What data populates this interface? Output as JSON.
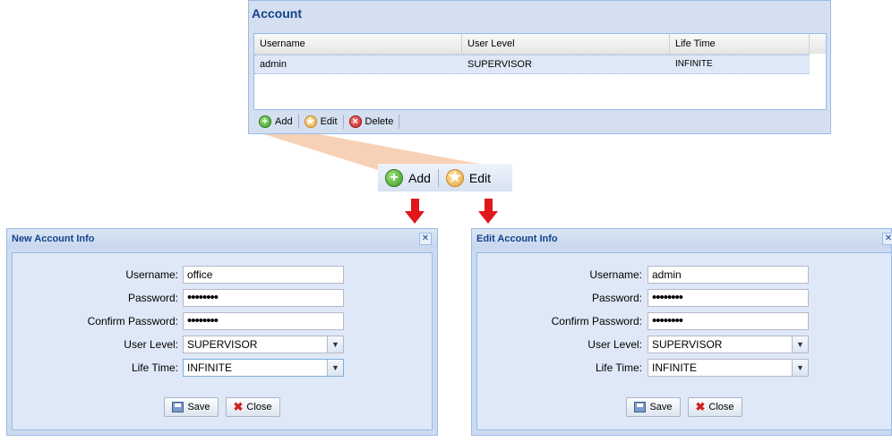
{
  "account": {
    "title": "Account",
    "columns": [
      "Username",
      "User Level",
      "Life Time"
    ],
    "rows": [
      [
        "admin",
        "SUPERVISOR",
        "INFINITE"
      ]
    ],
    "toolbar": {
      "add": "Add",
      "edit": "Edit",
      "delete": "Delete"
    }
  },
  "zoom": {
    "add": "Add",
    "edit": "Edit"
  },
  "new_dialog": {
    "title": "New Account Info",
    "labels": {
      "username": "Username:",
      "password": "Password:",
      "confirm": "Confirm Password:",
      "level": "User Level:",
      "lifetime": "Life Time:"
    },
    "values": {
      "username": "office",
      "password": "••••••••",
      "confirm": "••••••••",
      "level": "SUPERVISOR",
      "lifetime": "INFINITE"
    },
    "save": "Save",
    "close": "Close"
  },
  "edit_dialog": {
    "title": "Edit Account Info",
    "labels": {
      "username": "Username:",
      "password": "Password:",
      "confirm": "Confirm Password:",
      "level": "User Level:",
      "lifetime": "Life Time:"
    },
    "values": {
      "username": "admin",
      "password": "••••••••",
      "confirm": "••••••••",
      "level": "SUPERVISOR",
      "lifetime": "INFINITE"
    },
    "save": "Save",
    "close": "Close"
  },
  "colors": {
    "arrow": "#e0161b",
    "callout": "#f6c9a8",
    "panel": "#d4dff0",
    "title": "#15428b"
  },
  "icons": [
    "add-icon",
    "edit-icon",
    "delete-icon",
    "close-icon",
    "save-icon",
    "chevron-down-icon",
    "down-arrow-icon"
  ]
}
